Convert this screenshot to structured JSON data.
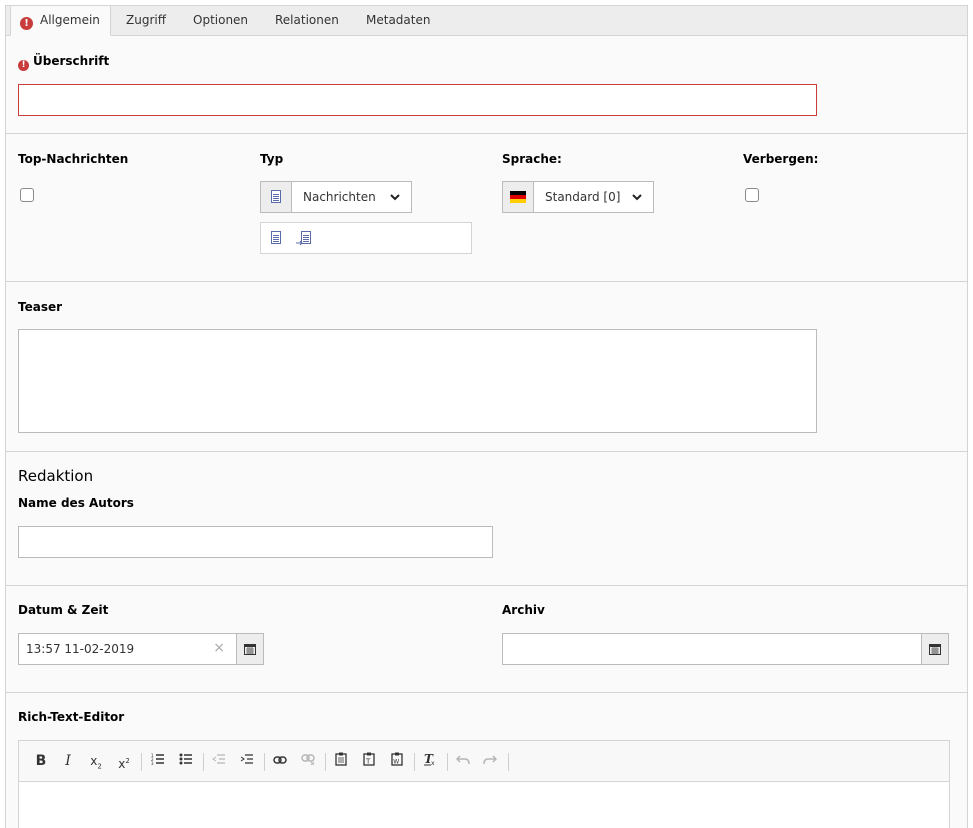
{
  "tabs": [
    {
      "label": "Allgemein",
      "active": true,
      "error": true
    },
    {
      "label": "Zugriff"
    },
    {
      "label": "Optionen"
    },
    {
      "label": "Relationen"
    },
    {
      "label": "Metadaten"
    }
  ],
  "fields": {
    "headline": {
      "label": "Überschrift",
      "value": "",
      "error": true
    },
    "top_news": {
      "label": "Top-Nachrichten",
      "checked": false
    },
    "type": {
      "label": "Typ",
      "selected": "Nachrichten"
    },
    "language": {
      "label": "Sprache:",
      "selected": "Standard [0]",
      "flag": "de-flag-icon"
    },
    "hidden": {
      "label": "Verbergen:",
      "checked": false
    },
    "teaser": {
      "label": "Teaser",
      "value": ""
    },
    "editorial_heading": "Redaktion",
    "author": {
      "label": "Name des Autors",
      "value": ""
    },
    "datetime": {
      "label": "Datum & Zeit",
      "value": "13:57 11-02-2019"
    },
    "archive": {
      "label": "Archiv",
      "value": ""
    },
    "rte": {
      "label": "Rich-Text-Editor"
    }
  },
  "icons": {
    "error": "!",
    "clear": "×"
  },
  "colors": {
    "error": "#c83c3c",
    "border": "#d4d4d4",
    "panel": "#fafafa",
    "tabbar": "#ededed"
  },
  "toolbar": [
    "bold-icon",
    "italic-icon",
    "subscript-icon",
    "superscript-icon",
    "numbered-list-icon",
    "bulleted-list-icon",
    "outdent-icon",
    "indent-icon",
    "link-icon",
    "unlink-icon",
    "paste-icon",
    "paste-text-icon",
    "paste-word-icon",
    "remove-format-icon",
    "undo-icon",
    "redo-icon"
  ]
}
